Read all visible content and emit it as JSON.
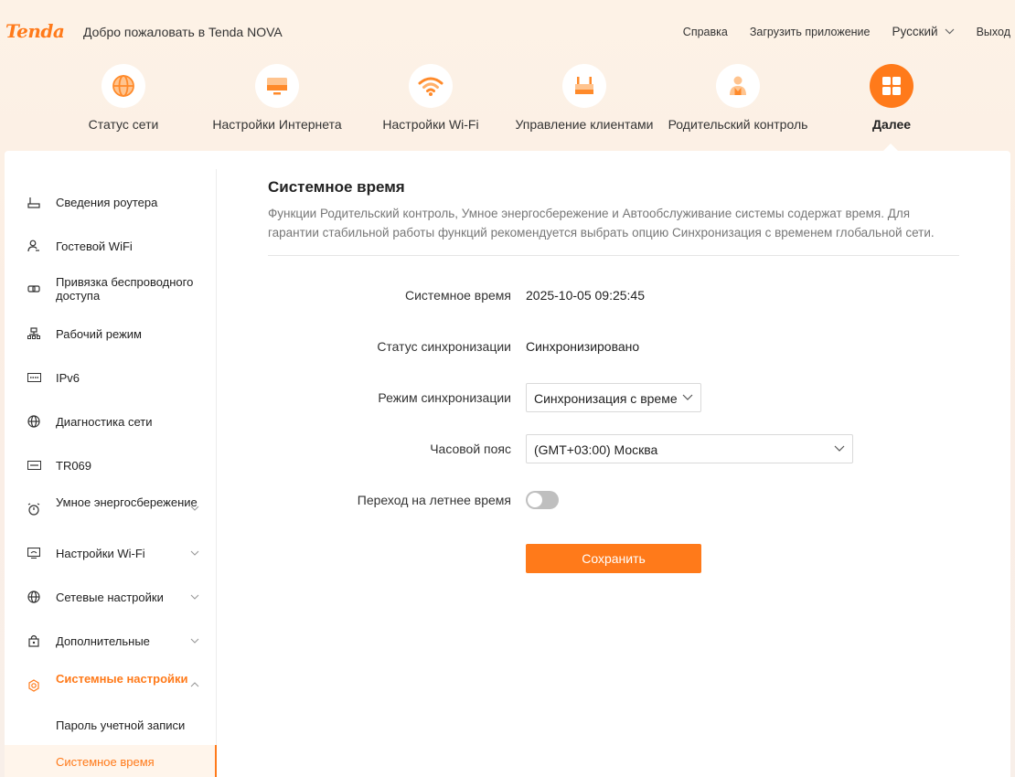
{
  "header": {
    "logo": "Tenda",
    "welcome": "Добро пожаловать в Tenda NOVA",
    "help": "Справка",
    "download_app": "Загрузить приложение",
    "language": "Русский",
    "logout": "Выход"
  },
  "topnav": [
    {
      "label": "Статус сети",
      "icon": "globe-icon"
    },
    {
      "label": "Настройки Интернета",
      "icon": "monitor-icon"
    },
    {
      "label": "Настройки Wi-Fi",
      "icon": "wifi-icon"
    },
    {
      "label": "Управление клиентами",
      "icon": "router-clients-icon"
    },
    {
      "label": "Родительский контроль",
      "icon": "parent-user-icon"
    },
    {
      "label": "Далее",
      "icon": "grid-icon",
      "active": true
    }
  ],
  "sidebar": {
    "items": [
      {
        "label": "Сведения роутера",
        "icon": "router-icon"
      },
      {
        "label": "Гостевой WiFi",
        "icon": "guest-user-icon"
      },
      {
        "label": "Привязка беспроводного доступа",
        "icon": "link-icon"
      },
      {
        "label": "Рабочий режим",
        "icon": "network-tree-icon"
      },
      {
        "label": "IPv6",
        "icon": "ipv6-icon"
      },
      {
        "label": "Диагностика сети",
        "icon": "globe-icon"
      },
      {
        "label": "TR069",
        "icon": "tr069-icon"
      },
      {
        "label": "Умное энергосбережение",
        "icon": "alarm-icon",
        "expandable": true
      },
      {
        "label": "Настройки Wi-Fi",
        "icon": "wifi-settings-icon",
        "expandable": true
      },
      {
        "label": "Сетевые настройки",
        "icon": "globe-icon",
        "expandable": true
      },
      {
        "label": "Дополнительные",
        "icon": "lock-box-icon",
        "expandable": true
      },
      {
        "label": "Системные настройки",
        "icon": "gear-icon",
        "expandable": true,
        "expanded": true
      }
    ],
    "subitems": [
      {
        "label": "Пароль учетной записи"
      },
      {
        "label": "Системное время",
        "active": true
      }
    ]
  },
  "content": {
    "title": "Системное время",
    "description": "Функции Родительский контроль, Умное энергосбережение и Автообслуживание системы содержат время. Для гарантии стабильной работы функций рекомендуется выбрать опцию Синхронизация с временем глобальной сети.",
    "fields": {
      "system_time_label": "Системное время",
      "system_time_value": "2025-10-05 09:25:45",
      "sync_status_label": "Статус синхронизации",
      "sync_status_value": "Синхронизировано",
      "sync_mode_label": "Режим синхронизации",
      "sync_mode_value": "Синхронизация с време",
      "timezone_label": "Часовой пояс",
      "timezone_value": "(GMT+03:00) Москва",
      "dst_label": "Переход на летнее время",
      "dst_on": false
    },
    "save_label": "Сохранить"
  },
  "colors": {
    "accent": "#ff7a1a",
    "text": "#333333",
    "muted": "#777777"
  }
}
